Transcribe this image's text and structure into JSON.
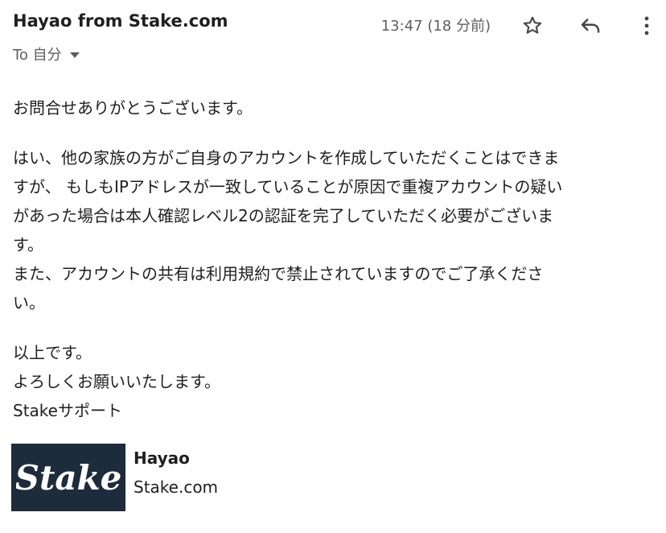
{
  "email": {
    "sender": "Hayao from Stake.com",
    "recipient": "To 自分",
    "timestamp": "13:47 (18 分前)"
  },
  "icons": {
    "star": "star-icon",
    "reply": "reply-icon",
    "more": "more-vert-icon",
    "recipient_dropdown": "chevron-down-icon"
  },
  "body": {
    "greeting": "お問合せありがとうございます。",
    "paragraph": "はい、他の家族の方がご自身のアカウントを作成していただくことはできま\nすが、 もしもIPアドレスが一致していることが原因で重複アカウントの疑い\nがあった場合は本人確認レベル2の認証を完了していただく必要がございま\nす。\nまた、アカウントの共有は利用規約で禁止されていますのでご了承くださ\nい。",
    "closing_1": "以上です。",
    "closing_2": "よろしくお願いいたします。",
    "closing_3": "Stakeサポート"
  },
  "signature": {
    "logo_text": "Stake",
    "name": "Hayao",
    "company": "Stake.com"
  },
  "colors": {
    "logo_background": "#1d2c3a",
    "text_primary": "#1f1f1f",
    "text_secondary": "#5e5e5e"
  }
}
